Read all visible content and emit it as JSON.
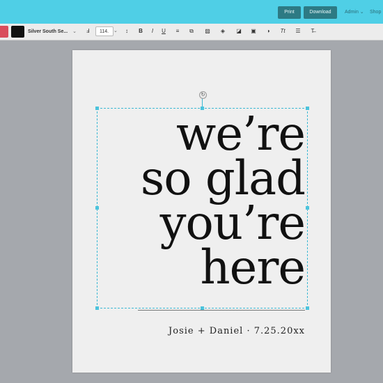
{
  "header": {
    "print_label": "Print",
    "download_label": "Download",
    "admin_label": "Admin",
    "shop_label": "Shop"
  },
  "toolbar": {
    "font_name": "Silver South Se...",
    "font_size": "114.",
    "tools": [
      {
        "name": "font-effect-icon",
        "glyph": "Ⅎ"
      },
      {
        "name": "line-height-icon",
        "glyph": "↕"
      },
      {
        "name": "bold-icon",
        "glyph": "B"
      },
      {
        "name": "italic-icon",
        "glyph": "I"
      },
      {
        "name": "underline-icon",
        "glyph": "U"
      },
      {
        "name": "align-icon",
        "glyph": "≡"
      },
      {
        "name": "duplicate-icon",
        "glyph": "⧉"
      },
      {
        "name": "replace-image-icon",
        "glyph": "▨"
      },
      {
        "name": "layers-icon",
        "glyph": "◈"
      },
      {
        "name": "flip-icon",
        "glyph": "◪"
      },
      {
        "name": "lock-icon",
        "glyph": "▣"
      },
      {
        "name": "color-icon",
        "glyph": "◑"
      },
      {
        "name": "text-transform-icon",
        "glyph": "Tt"
      },
      {
        "name": "spacing-icon",
        "glyph": "☰"
      },
      {
        "name": "clear-format-icon",
        "glyph": "T̶"
      }
    ]
  },
  "canvas": {
    "headline_lines": [
      "we’re",
      "so glad",
      "you’re",
      "here"
    ],
    "signature": "Josie + Daniel · 7.25.20xx"
  },
  "colors": {
    "topbar": "#4fcfe6",
    "accent_button": "#2d7a84",
    "selection": "#3bb8d3"
  }
}
